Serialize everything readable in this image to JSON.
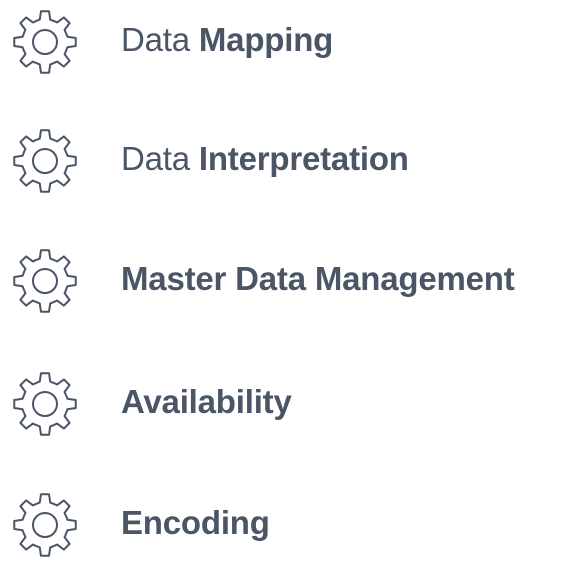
{
  "colors": {
    "text": "#4a5566",
    "icon": "#4a5566"
  },
  "items": [
    {
      "icon": "gear-icon",
      "light": "Data",
      "bold": "Mapping"
    },
    {
      "icon": "gear-icon",
      "light": "Data",
      "bold": "Interpretation"
    },
    {
      "icon": "gear-icon",
      "light": "",
      "bold": "Master Data Management"
    },
    {
      "icon": "gear-icon",
      "light": "",
      "bold": "Availability"
    },
    {
      "icon": "gear-icon",
      "light": "",
      "bold": "Encoding"
    }
  ]
}
